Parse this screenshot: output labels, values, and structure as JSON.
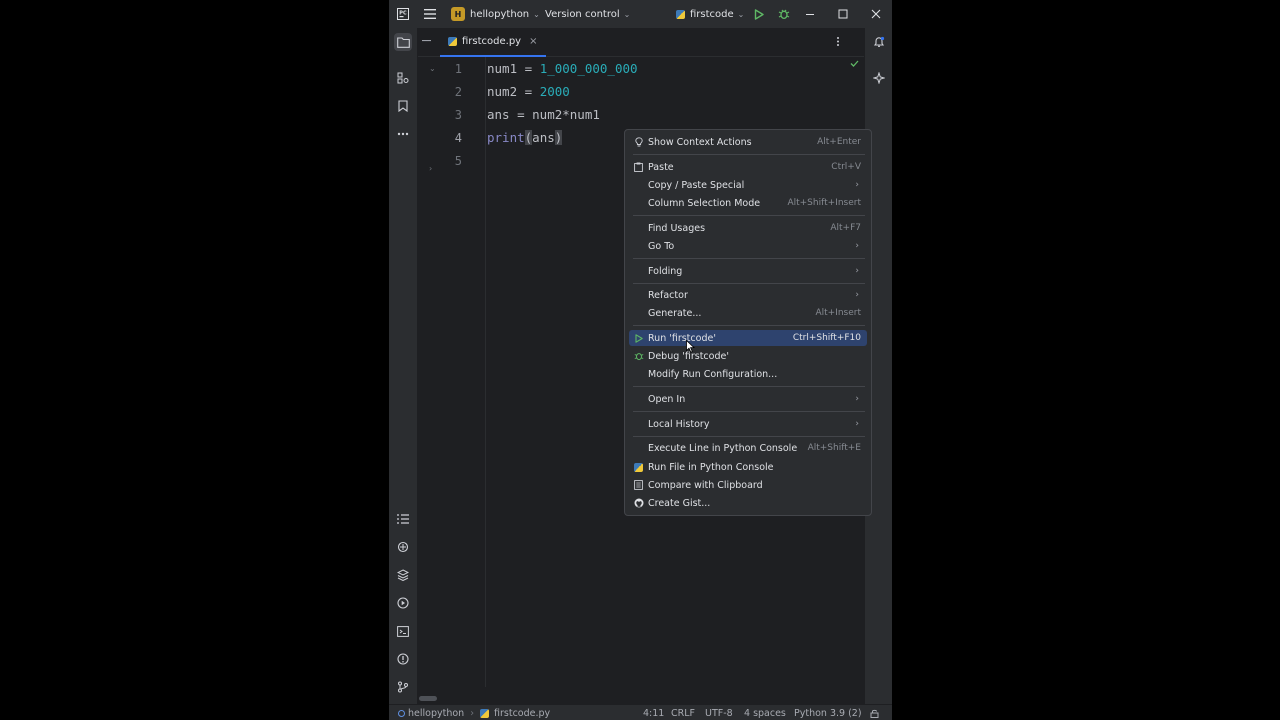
{
  "titlebar": {
    "project_badge": "H",
    "project_name": "hellopython",
    "vcs_label": "Version control",
    "run_config": "firstcode"
  },
  "tab": {
    "file_name": "firstcode.py",
    "close_glyph": "×"
  },
  "editor": {
    "line_numbers": [
      "1",
      "2",
      "3",
      "4",
      "5"
    ],
    "lines": [
      {
        "a": "num1 = ",
        "b": "1_000_000_000"
      },
      {
        "a": "num2 = ",
        "b": "2000"
      },
      {
        "a": "ans = num2*num1"
      },
      {
        "fn": "print",
        "p1": "(",
        "arg": "ans",
        "p2": ")"
      }
    ]
  },
  "context_menu": {
    "items": [
      {
        "label": "Show Context Actions",
        "shortcut": "Alt+Enter",
        "icon": "lightbulb-icon"
      },
      {
        "label": "Paste",
        "shortcut": "Ctrl+V",
        "icon": "paste-icon"
      },
      {
        "label": "Copy / Paste Special",
        "arrow": "›"
      },
      {
        "label": "Column Selection Mode",
        "shortcut": "Alt+Shift+Insert"
      },
      {
        "label": "Find Usages",
        "shortcut": "Alt+F7"
      },
      {
        "label": "Go To",
        "arrow": "›"
      },
      {
        "label": "Folding",
        "arrow": "›"
      },
      {
        "label": "Refactor",
        "arrow": "›"
      },
      {
        "label": "Generate...",
        "shortcut": "Alt+Insert"
      },
      {
        "label": "Run 'firstcode'",
        "shortcut": "Ctrl+Shift+F10",
        "icon": "run-icon",
        "selected": true
      },
      {
        "label": "Debug 'firstcode'",
        "icon": "debug-icon"
      },
      {
        "label": "Modify Run Configuration..."
      },
      {
        "label": "Open In",
        "arrow": "›"
      },
      {
        "label": "Local History",
        "arrow": "›"
      },
      {
        "label": "Execute Line in Python Console",
        "shortcut": "Alt+Shift+E"
      },
      {
        "label": "Run File in Python Console",
        "icon": "python-icon"
      },
      {
        "label": "Compare with Clipboard",
        "icon": "compare-icon"
      },
      {
        "label": "Create Gist...",
        "icon": "github-icon"
      }
    ]
  },
  "statusbar": {
    "project": "hellopython",
    "file": "firstcode.py",
    "position": "4:11",
    "line_ending": "CRLF",
    "encoding": "UTF-8",
    "indent": "4 spaces",
    "interpreter": "Python 3.9 (2)"
  },
  "colors": {
    "background": "#1e1f22",
    "panel": "#2b2d30",
    "accent": "#3574f0",
    "selection": "#2e436e",
    "number": "#2aacb8",
    "run_green": "#5fb865"
  }
}
